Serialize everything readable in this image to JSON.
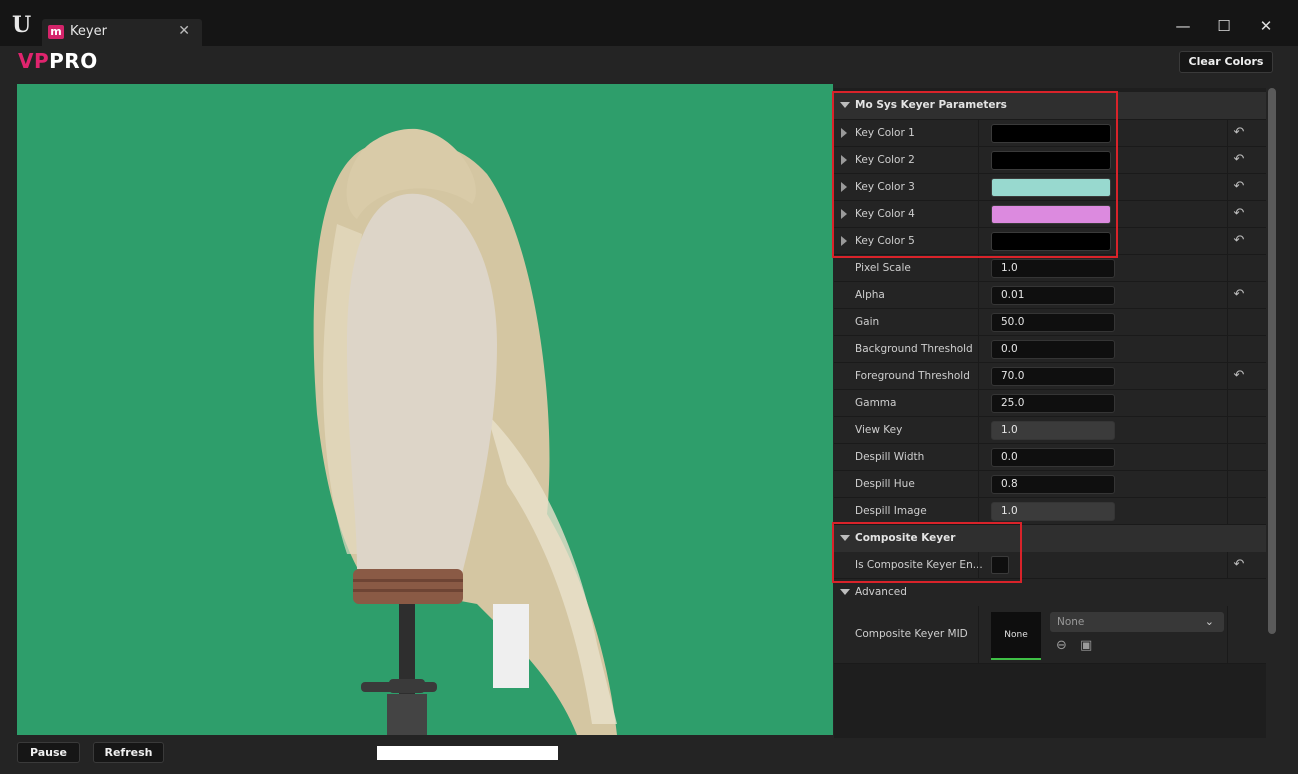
{
  "window": {
    "tab_title": "Keyer",
    "tab_icon_letter": "m",
    "ue_logo": "U",
    "minimize_icon": "—",
    "maximize_icon": "☐",
    "close_icon": "✕",
    "tab_close": "✕"
  },
  "toolbar": {
    "brand_vp": "VP",
    "brand_pro": "PRO",
    "clear_colors_label": "Clear Colors"
  },
  "sections": {
    "keyer_params": "Mo Sys Keyer Parameters",
    "composite_keyer": "Composite Keyer",
    "advanced": "Advanced"
  },
  "key_colors": [
    {
      "label": "Key Color 1",
      "color": "#000000"
    },
    {
      "label": "Key Color 2",
      "color": "#000000"
    },
    {
      "label": "Key Color 3",
      "color": "#98d9cf"
    },
    {
      "label": "Key Color 4",
      "color": "#dc8adf"
    },
    {
      "label": "Key Color 5",
      "color": "#000000"
    }
  ],
  "params": [
    {
      "label": "Pixel Scale",
      "value": "1.0",
      "reset": false,
      "style": "dark"
    },
    {
      "label": "Alpha",
      "value": "0.01",
      "reset": true,
      "style": "dark"
    },
    {
      "label": "Gain",
      "value": "50.0",
      "reset": false,
      "style": "dark"
    },
    {
      "label": "Background Threshold",
      "value": "0.0",
      "reset": false,
      "style": "dark"
    },
    {
      "label": "Foreground Threshold",
      "value": "70.0",
      "reset": true,
      "style": "dark"
    },
    {
      "label": "Gamma",
      "value": "25.0",
      "reset": false,
      "style": "dark"
    },
    {
      "label": "View Key",
      "value": "1.0",
      "reset": false,
      "style": "light"
    },
    {
      "label": "Despill Width",
      "value": "0.0",
      "reset": false,
      "style": "dark"
    },
    {
      "label": "Despill Hue",
      "value": "0.8",
      "reset": false,
      "style": "dark"
    },
    {
      "label": "Despill Image",
      "value": "1.0",
      "reset": false,
      "style": "light"
    }
  ],
  "composite": {
    "enabled_label": "Is Composite Keyer En...",
    "enabled": false
  },
  "advanced": {
    "mid_label": "Composite Keyer MID",
    "thumb_label": "None",
    "dropdown_value": "None"
  },
  "reset_icon": "↶",
  "bottom": {
    "pause_label": "Pause",
    "refresh_label": "Refresh"
  },
  "colors": {
    "accent_highlight": "#d9232a",
    "green_screen": "#2e9e6b",
    "brand_pink": "#e0246e"
  }
}
